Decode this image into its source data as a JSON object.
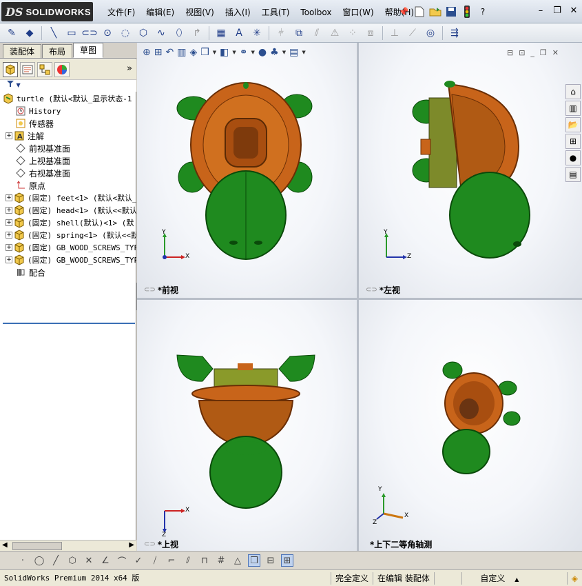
{
  "app": {
    "brand": "SOLIDWORKS",
    "brand_prefix": "DS"
  },
  "menu": [
    "文件(F)",
    "编辑(E)",
    "视图(V)",
    "插入(I)",
    "工具(T)",
    "Toolbox",
    "窗口(W)",
    "帮助(H)"
  ],
  "panel": {
    "tabs": [
      "装配体",
      "布局",
      "草图"
    ],
    "active_tab": "草图",
    "expand_glyph": "»",
    "filter_glyph": "▼"
  },
  "tree": {
    "root": "turtle  (默认<默认_显示状态-1",
    "items": [
      {
        "label": "History",
        "icon": "history-icon"
      },
      {
        "label": "传感器",
        "icon": "sensor-icon"
      },
      {
        "label": "注解",
        "icon": "annotation-icon"
      },
      {
        "label": "前视基准面",
        "icon": "plane-icon"
      },
      {
        "label": "上视基准面",
        "icon": "plane-icon"
      },
      {
        "label": "右视基准面",
        "icon": "plane-icon"
      },
      {
        "label": "原点",
        "icon": "origin-icon"
      },
      {
        "label": "(固定) feet<1> (默认<默认_",
        "icon": "part-icon"
      },
      {
        "label": "(固定) head<1> (默认<<默认",
        "icon": "part-icon"
      },
      {
        "label": "(固定) shell(默认)<1> (默",
        "icon": "part-icon"
      },
      {
        "label": "(固定) spring<1> (默认<<默",
        "icon": "part-icon"
      },
      {
        "label": "(固定) GB_WOOD_SCREWS_TYPE",
        "icon": "part-icon"
      },
      {
        "label": "(固定) GB_WOOD_SCREWS_TYPE",
        "icon": "part-icon"
      },
      {
        "label": "配合",
        "icon": "mate-icon"
      }
    ]
  },
  "viewports": {
    "front": "*前视",
    "left": "*左视",
    "top": "*上视",
    "iso": "*上下二等角轴测"
  },
  "axes": {
    "x": "X",
    "y": "Y",
    "z": "Z"
  },
  "status": {
    "product": "SolidWorks Premium 2014 x64 版",
    "definition": "完全定义",
    "editing": "在编辑 装配体",
    "units": "自定义"
  },
  "colors": {
    "shell": "#c8641a",
    "body": "#1f8a1f",
    "accent": "#2c4f8f"
  }
}
